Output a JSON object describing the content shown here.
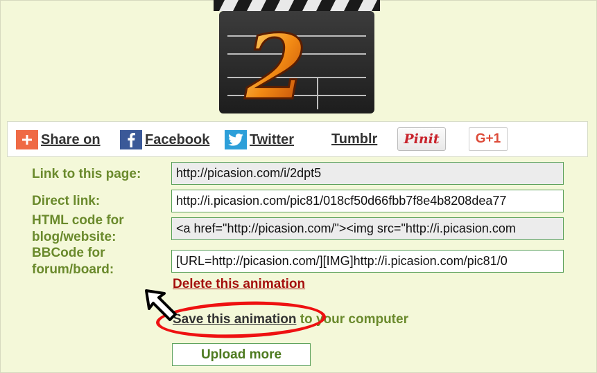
{
  "share": {
    "share_on": "Share on",
    "facebook": "Facebook",
    "twitter": "Twitter",
    "tumblr": "Tumblr",
    "pinterest": "Pinit",
    "gplus": "G+1"
  },
  "links": {
    "page_label": "Link to this page:",
    "page_value": "http://picasion.com/i/2dpt5",
    "direct_label": "Direct link:",
    "direct_value": "http://i.picasion.com/pic81/018cf50d66fbb7f8e4b8208dea77",
    "html_label_1": "HTML code for",
    "html_label_2": "blog/website:",
    "html_value": "<a href=\"http://picasion.com/\"><img src=\"http://i.picasion.com",
    "bbcode_label_1": "BBCode for",
    "bbcode_label_2": "forum/board:",
    "bbcode_value": "[URL=http://picasion.com/][IMG]http://i.picasion.com/pic81/0"
  },
  "actions": {
    "delete": "Delete this animation",
    "save": "Save this animation",
    "save_suffix": " to your computer",
    "upload_more": "Upload more"
  },
  "colors": {
    "background": "#f4f8d9",
    "label_green": "#6a8a2c",
    "delete_red": "#a5100e",
    "highlight_red": "#ee1111"
  }
}
